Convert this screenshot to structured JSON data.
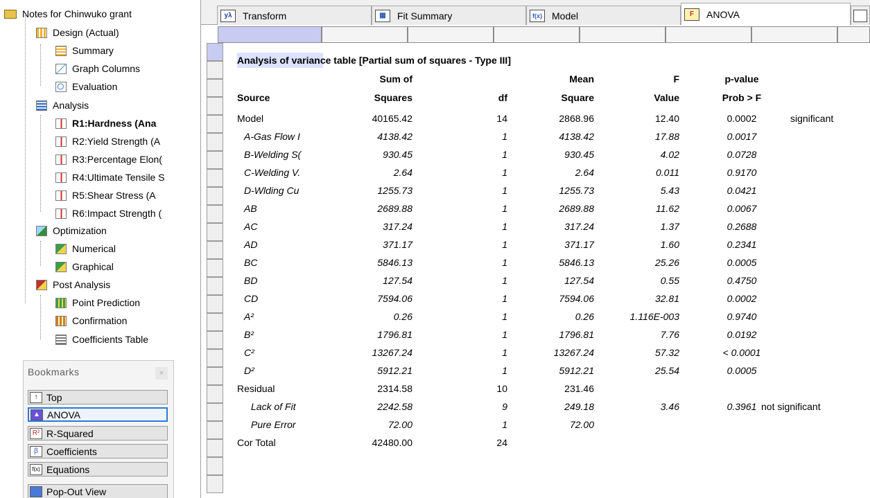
{
  "sidebar": {
    "root": "Notes for Chinwuko grant",
    "design": "Design (Actual)",
    "summary": "Summary",
    "graph_columns": "Graph Columns",
    "evaluation": "Evaluation",
    "analysis": "Analysis",
    "responses": [
      "R1:Hardness (Ana",
      "R2:Yield Strength (A",
      "R3:Percentage Elon(",
      "R4:Ultimate Tensile S",
      "R5:Shear Stress (A",
      "R6:Impact Strength ("
    ],
    "optimization": "Optimization",
    "numerical": "Numerical",
    "graphical": "Graphical",
    "post_analysis": "Post Analysis",
    "point_prediction": "Point Prediction",
    "confirmation": "Confirmation",
    "coefficients_table": "Coefficients Table"
  },
  "bookmarks": {
    "title": "Bookmarks",
    "close": "×",
    "items": [
      "Top",
      "ANOVA",
      "R-Squared",
      "Coefficients",
      "Equations",
      "Pop-Out View"
    ]
  },
  "tabs": [
    "Transform",
    "Fit Summary",
    "Model",
    "ANOVA"
  ],
  "tab_icons": [
    "yλ",
    "▦",
    "f(x)",
    "F"
  ],
  "table": {
    "title": "Analysis of variance table [Partial sum of squares - Type III]",
    "headers_top": [
      "Sum of",
      "Mean",
      "F",
      "p-value"
    ],
    "headers_bottom": [
      "Source",
      "Squares",
      "df",
      "Square",
      "Value",
      "Prob > F"
    ],
    "rows": [
      [
        "Model",
        "40165.42",
        "14",
        "2868.96",
        "12.40",
        "0.0002",
        "significant"
      ],
      [
        "A-Gas Flow I",
        "4138.42",
        "1",
        "4138.42",
        "17.88",
        "0.0017",
        ""
      ],
      [
        "B-Welding S(",
        "930.45",
        "1",
        "930.45",
        "4.02",
        "0.0728",
        ""
      ],
      [
        "C-Welding V.",
        "2.64",
        "1",
        "2.64",
        "0.011",
        "0.9170",
        ""
      ],
      [
        "D-Wlding Cu",
        "1255.73",
        "1",
        "1255.73",
        "5.43",
        "0.0421",
        ""
      ],
      [
        "AB",
        "2689.88",
        "1",
        "2689.88",
        "11.62",
        "0.0067",
        ""
      ],
      [
        "AC",
        "317.24",
        "1",
        "317.24",
        "1.37",
        "0.2688",
        ""
      ],
      [
        "AD",
        "371.17",
        "1",
        "371.17",
        "1.60",
        "0.2341",
        ""
      ],
      [
        "BC",
        "5846.13",
        "1",
        "5846.13",
        "25.26",
        "0.0005",
        ""
      ],
      [
        "BD",
        "127.54",
        "1",
        "127.54",
        "0.55",
        "0.4750",
        ""
      ],
      [
        "CD",
        "7594.06",
        "1",
        "7594.06",
        "32.81",
        "0.0002",
        ""
      ],
      [
        "A²",
        "0.26",
        "1",
        "0.26",
        "1.116E-003",
        "0.9740",
        ""
      ],
      [
        "B²",
        "1796.81",
        "1",
        "1796.81",
        "7.76",
        "0.0192",
        ""
      ],
      [
        "C²",
        "13267.24",
        "1",
        "13267.24",
        "57.32",
        "< 0.0001",
        ""
      ],
      [
        "D²",
        "5912.21",
        "1",
        "5912.21",
        "25.54",
        "0.0005",
        ""
      ],
      [
        "Residual",
        "2314.58",
        "10",
        "231.46",
        "",
        "",
        ""
      ],
      [
        "Lack of Fit",
        "2242.58",
        "9",
        "249.18",
        "3.46",
        "0.3961",
        "not significant"
      ],
      [
        "Pure Error",
        "72.00",
        "1",
        "72.00",
        "",
        "",
        ""
      ],
      [
        "Cor Total",
        "42480.00",
        "24",
        "",
        "",
        "",
        ""
      ]
    ],
    "row_style": [
      "n",
      "it",
      "it",
      "it",
      "it",
      "it",
      "it",
      "it",
      "it",
      "it",
      "it",
      "it",
      "it",
      "it",
      "it",
      "n",
      "it2",
      "it2",
      "n"
    ]
  }
}
